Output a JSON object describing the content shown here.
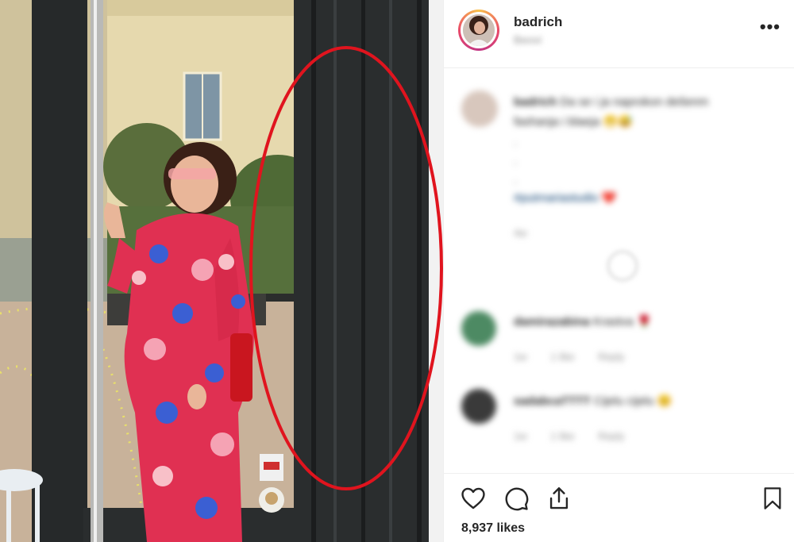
{
  "post": {
    "username": "badrich",
    "location": "Beovi",
    "more_icon": "more-dots-icon",
    "likes": "8,937 likes"
  },
  "comments": [
    {
      "author": "badrich",
      "text": "Da se i ja naprokon dešenm",
      "line2": "fashanja i blaeja",
      "emoji": "😁😅",
      "dots": [
        ".",
        ".",
        "."
      ],
      "hashtag": "#putmariastudio",
      "heart": "❤️",
      "meta": "4w"
    },
    {
      "author": "damirazabina",
      "text": "Krastva",
      "emoji": "🌹",
      "meta_time": "1w",
      "meta_likes": "1 like",
      "meta_reply": "Reply"
    },
    {
      "author": "sadabcaTTTT",
      "text": "Cijelu cijelu",
      "emoji": "😊",
      "meta_time": "1w",
      "meta_likes": "1 like",
      "meta_reply": "Reply"
    }
  ],
  "icons": {
    "like": "heart-icon",
    "comment": "comment-icon",
    "share": "share-icon",
    "save": "bookmark-icon"
  },
  "colors": {
    "annotation_ellipse": "#e0141e",
    "text_primary": "#262626",
    "text_secondary": "#8e8e8e",
    "hashtag": "#00376b"
  }
}
